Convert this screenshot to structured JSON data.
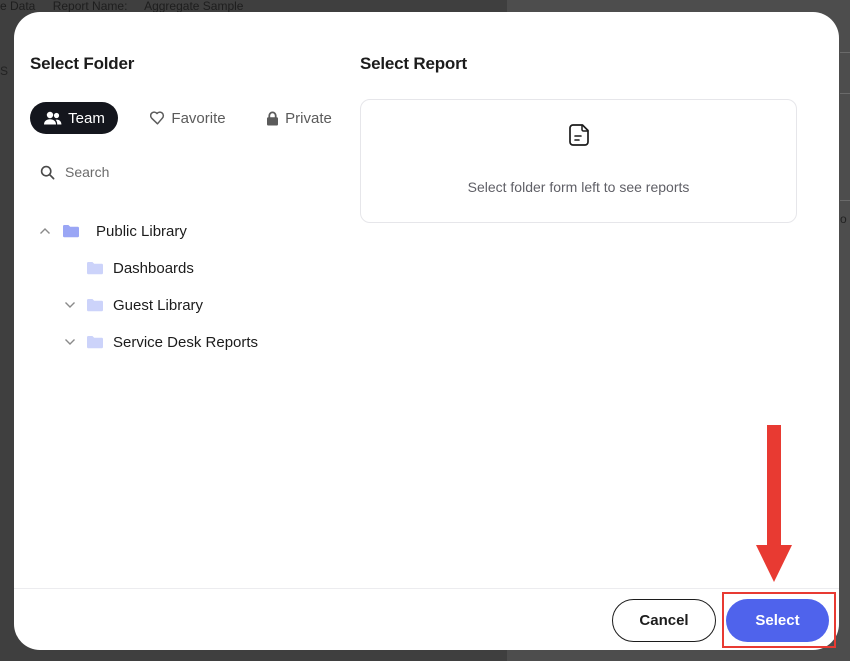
{
  "background": {
    "top_texts": [
      "e Data",
      "Report Name:",
      "Aggregate Sample"
    ],
    "left_edge_text": "S",
    "right_edge_text": "o"
  },
  "left_panel": {
    "title": "Select Folder",
    "tabs": [
      {
        "label": "Team",
        "icon": "team-icon",
        "active": true
      },
      {
        "label": "Favorite",
        "icon": "heart-icon",
        "active": false
      },
      {
        "label": "Private",
        "icon": "lock-icon",
        "active": false
      }
    ],
    "search": {
      "placeholder": "Search",
      "value": ""
    },
    "tree": [
      {
        "label": "Public Library",
        "expanded": true,
        "chevron": "chevron-up-icon"
      },
      {
        "label": "Dashboards",
        "chevron": "none"
      },
      {
        "label": "Guest Library",
        "expanded": false,
        "chevron": "chevron-down-icon"
      },
      {
        "label": "Service Desk Reports",
        "expanded": false,
        "chevron": "chevron-down-icon"
      }
    ]
  },
  "right_panel": {
    "title": "Select Report",
    "empty_icon": "document-icon",
    "empty_message": "Select folder form left to see reports"
  },
  "footer": {
    "cancel_label": "Cancel",
    "select_label": "Select"
  },
  "colors": {
    "accent": "#4f63ec",
    "active_tab": "#14161d",
    "folder": "#9aa6f5",
    "annotation": "#e83a32"
  }
}
